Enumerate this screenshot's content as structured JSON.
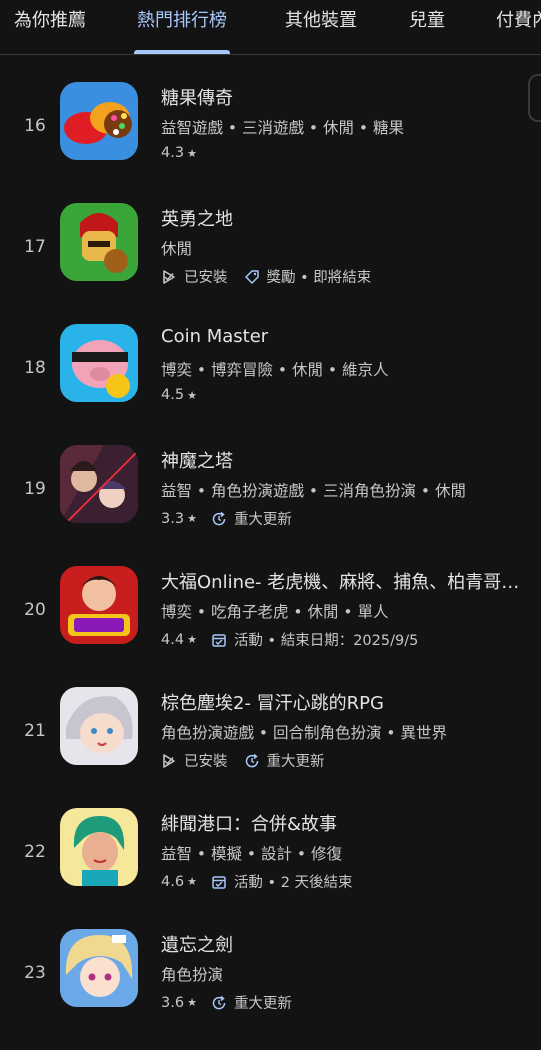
{
  "tabs": [
    {
      "label": "為你推薦",
      "active": false
    },
    {
      "label": "熱門排行榜",
      "active": true
    },
    {
      "label": "其他裝置",
      "active": false
    },
    {
      "label": "兒童",
      "active": false
    },
    {
      "label": "付費內容",
      "active": false
    }
  ],
  "apps": [
    {
      "rank": "16",
      "title": "糖果傳奇",
      "tags": "益智遊戲 • 三消遊戲 • 休閒 • 糖果",
      "rating": "4.3",
      "badge": "",
      "icon": "candy-crush-icon"
    },
    {
      "rank": "17",
      "title": "英勇之地",
      "tags": "休閒",
      "installed": "已安裝",
      "badge": "獎勵 • 即將結束",
      "icon": "hero-land-icon"
    },
    {
      "rank": "18",
      "title": "Coin Master",
      "tags": "博奕 • 博弈冒險 • 休閒 • 維京人",
      "rating": "4.5",
      "badge": "",
      "icon": "coin-master-icon"
    },
    {
      "rank": "19",
      "title": "神魔之塔",
      "tags": "益智 • 角色扮演遊戲 • 三消角色扮演 • 休閒",
      "rating": "3.3",
      "badge": "重大更新",
      "icon": "tower-of-saviors-icon"
    },
    {
      "rank": "20",
      "title": "大福Online- 老虎機、麻將、捕魚、柏青哥、百家樂",
      "tags": "博奕 • 吃角子老虎 • 休閒 • 單人",
      "rating": "4.4",
      "badge": "活動 • 結束日期：2025/9/5",
      "icon": "dafu-online-icon"
    },
    {
      "rank": "21",
      "title": "棕色塵埃2- 冒汗心跳的RPG",
      "tags": "角色扮演遊戲 • 回合制角色扮演 • 異世界",
      "installed": "已安裝",
      "badge": "重大更新",
      "icon": "brown-dust-2-icon"
    },
    {
      "rank": "22",
      "title": "緋聞港口：合併&故事",
      "tags": "益智 • 模擬 • 設計 • 修復",
      "rating": "4.6",
      "badge": "活動 • 2 天後結束",
      "icon": "gossip-harbor-icon"
    },
    {
      "rank": "23",
      "title": "遺忘之劍",
      "tags": "角色扮演",
      "rating": "3.6",
      "badge": "重大更新",
      "icon": "forgotten-sword-icon"
    }
  ],
  "colors": {
    "background": "#131314",
    "accent": "#a8c7fa",
    "text": "#e3e3e3",
    "secondary": "#c4c7c5"
  }
}
